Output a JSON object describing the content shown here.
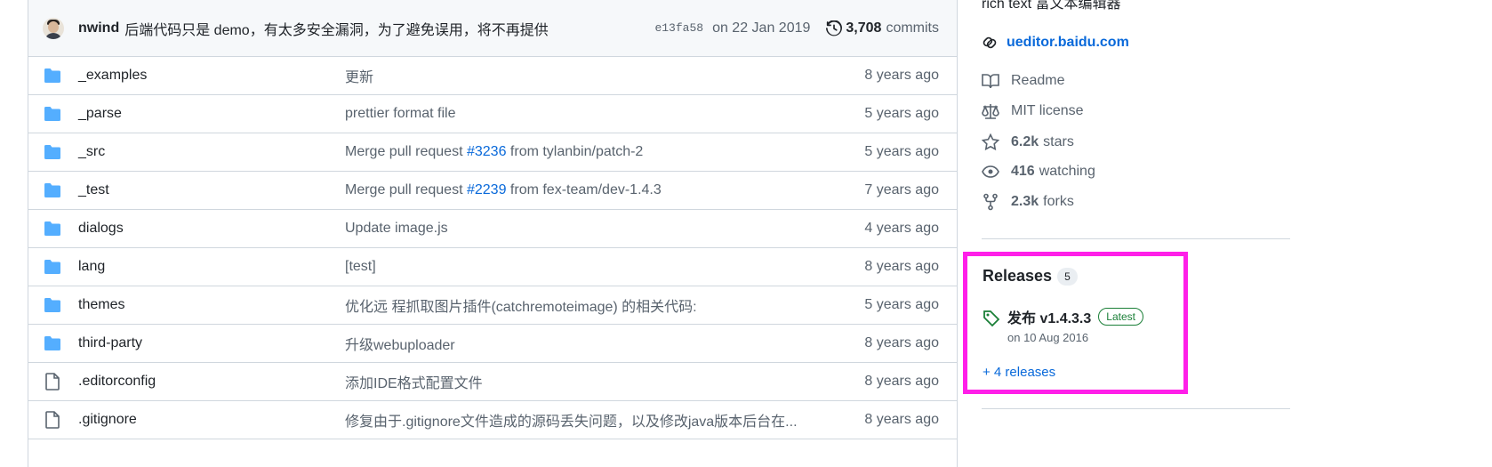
{
  "commit": {
    "author": "nwind",
    "message": "后端代码只是 demo，有太多安全漏洞，为了避免误用，将不再提供",
    "sha": "e13fa58",
    "date": "on 22 Jan 2019",
    "count": "3,708",
    "count_label": "commits"
  },
  "files": [
    {
      "type": "folder",
      "name": "_examples",
      "msg_pre": "更新",
      "link": "",
      "msg_post": "",
      "age": "8 years ago"
    },
    {
      "type": "folder",
      "name": "_parse",
      "msg_pre": "prettier format file",
      "link": "",
      "msg_post": "",
      "age": "5 years ago"
    },
    {
      "type": "folder",
      "name": "_src",
      "msg_pre": "Merge pull request ",
      "link": "#3236",
      "msg_post": " from tylanbin/patch-2",
      "age": "5 years ago"
    },
    {
      "type": "folder",
      "name": "_test",
      "msg_pre": "Merge pull request ",
      "link": "#2239",
      "msg_post": " from fex-team/dev-1.4.3",
      "age": "7 years ago"
    },
    {
      "type": "folder",
      "name": "dialogs",
      "msg_pre": "Update image.js",
      "link": "",
      "msg_post": "",
      "age": "4 years ago"
    },
    {
      "type": "folder",
      "name": "lang",
      "msg_pre": "[test]",
      "link": "",
      "msg_post": "",
      "age": "8 years ago"
    },
    {
      "type": "folder",
      "name": "themes",
      "msg_pre": "优化远 程抓取图片插件(catchremoteimage) 的相关代码:",
      "link": "",
      "msg_post": "",
      "age": "5 years ago"
    },
    {
      "type": "folder",
      "name": "third-party",
      "msg_pre": "升级webuploader",
      "link": "",
      "msg_post": "",
      "age": "8 years ago"
    },
    {
      "type": "file",
      "name": ".editorconfig",
      "msg_pre": "添加IDE格式配置文件",
      "link": "",
      "msg_post": "",
      "age": "8 years ago"
    },
    {
      "type": "file",
      "name": ".gitignore",
      "msg_pre": "修复由于.gitignore文件造成的源码丢失问题，以及修改java版本后台在...",
      "link": "",
      "msg_post": "",
      "age": "8 years ago"
    }
  ],
  "sidebar": {
    "description": "rich text 富文本编辑器",
    "homepage": "ueditor.baidu.com",
    "readme": "Readme",
    "license": "MIT license",
    "stars_count": "6.2k",
    "stars_label": "stars",
    "watching_count": "416",
    "watching_label": "watching",
    "forks_count": "2.3k",
    "forks_label": "forks"
  },
  "releases": {
    "title": "Releases",
    "count": "5",
    "latest_name": "发布 v1.4.3.3",
    "latest_badge": "Latest",
    "latest_date": "on 10 Aug 2016",
    "more": "+ 4 releases"
  },
  "colors": {
    "folder": "#54aeff",
    "link": "#0969da",
    "highlight": "#ff1fe9",
    "latest_badge": "#1a7f37"
  }
}
